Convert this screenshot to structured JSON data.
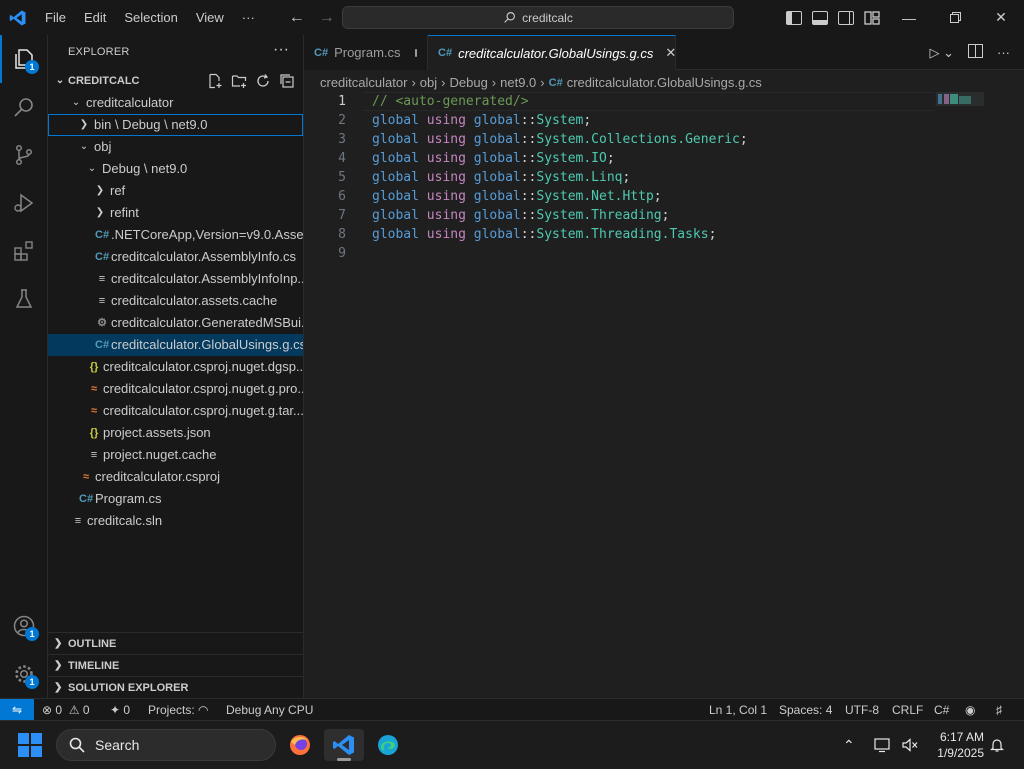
{
  "titlebar": {
    "menus": [
      "File",
      "Edit",
      "Selection",
      "View",
      "···"
    ],
    "search_text": "creditcalc"
  },
  "activity": {
    "explorer_badge": "1",
    "accounts_badge": "1",
    "manage_badge": "1"
  },
  "sidebar": {
    "title": "EXPLORER",
    "root": "CREDITCALC",
    "tree": [
      {
        "label": "creditcalculator",
        "depth": 1,
        "chevron": "down",
        "icon": ""
      },
      {
        "label": "bin \\ Debug \\ net9.0",
        "depth": 2,
        "chevron": "right",
        "icon": "",
        "focused": true
      },
      {
        "label": "obj",
        "depth": 2,
        "chevron": "down",
        "icon": ""
      },
      {
        "label": "Debug \\ net9.0",
        "depth": 3,
        "chevron": "down",
        "icon": ""
      },
      {
        "label": "ref",
        "depth": 4,
        "chevron": "right",
        "icon": ""
      },
      {
        "label": "refint",
        "depth": 4,
        "chevron": "right",
        "icon": ""
      },
      {
        "label": ".NETCoreApp,Version=v9.0.Asse...",
        "depth": 4,
        "chevron": "",
        "icon": "cs"
      },
      {
        "label": "creditcalculator.AssemblyInfo.cs",
        "depth": 4,
        "chevron": "",
        "icon": "cs"
      },
      {
        "label": "creditcalculator.AssemblyInfoInp...",
        "depth": 4,
        "chevron": "",
        "icon": "txt"
      },
      {
        "label": "creditcalculator.assets.cache",
        "depth": 4,
        "chevron": "",
        "icon": "txt"
      },
      {
        "label": "creditcalculator.GeneratedMSBui...",
        "depth": 4,
        "chevron": "",
        "icon": "gear"
      },
      {
        "label": "creditcalculator.GlobalUsings.g.cs",
        "depth": 4,
        "chevron": "",
        "icon": "cs",
        "selected": true
      },
      {
        "label": "creditcalculator.csproj.nuget.dgsp...",
        "depth": 3,
        "chevron": "",
        "icon": "json"
      },
      {
        "label": "creditcalculator.csproj.nuget.g.pro...",
        "depth": 3,
        "chevron": "",
        "icon": "xml"
      },
      {
        "label": "creditcalculator.csproj.nuget.g.tar...",
        "depth": 3,
        "chevron": "",
        "icon": "xml"
      },
      {
        "label": "project.assets.json",
        "depth": 3,
        "chevron": "",
        "icon": "json"
      },
      {
        "label": "project.nuget.cache",
        "depth": 3,
        "chevron": "",
        "icon": "txt"
      },
      {
        "label": "creditcalculator.csproj",
        "depth": 2,
        "chevron": "",
        "icon": "xml"
      },
      {
        "label": "Program.cs",
        "depth": 2,
        "chevron": "",
        "icon": "cs"
      },
      {
        "label": "creditcalc.sln",
        "depth": 1,
        "chevron": "",
        "icon": "txt"
      }
    ],
    "sections": [
      "OUTLINE",
      "TIMELINE",
      "SOLUTION EXPLORER"
    ]
  },
  "editor": {
    "tabs": [
      {
        "label": "Program.cs",
        "active": false,
        "modified": true
      },
      {
        "label": "creditcalculator.GlobalUsings.g.cs",
        "active": true,
        "modified": false
      }
    ],
    "breadcrumb": [
      "creditcalculator",
      "obj",
      "Debug",
      "net9.0",
      "creditcalculator.GlobalUsings.g.cs"
    ],
    "lines": [
      {
        "n": "1",
        "comment": "// <auto-generated/>"
      },
      {
        "n": "2",
        "ns": "System"
      },
      {
        "n": "3",
        "ns": "System.Collections.Generic"
      },
      {
        "n": "4",
        "ns": "System.IO"
      },
      {
        "n": "5",
        "ns": "System.Linq"
      },
      {
        "n": "6",
        "ns": "System.Net.Http"
      },
      {
        "n": "7",
        "ns": "System.Threading"
      },
      {
        "n": "8",
        "ns": "System.Threading.Tasks"
      },
      {
        "n": "9"
      }
    ],
    "kw_global": "global",
    "kw_using": "using",
    "kw_prefix": "global",
    "sep": "::",
    "semi": ";"
  },
  "statusbar": {
    "errors": "0",
    "warnings": "0",
    "ports": "0",
    "projects": "Projects:",
    "config": "Debug Any CPU",
    "position": "Ln 1, Col 1",
    "spaces": "Spaces: 4",
    "encoding": "UTF-8",
    "eol": "CRLF",
    "language": "C#"
  },
  "taskbar": {
    "search_label": "Search",
    "time": "6:17 AM",
    "date": "1/9/2025"
  },
  "colors": {
    "accent": "#0078d4",
    "keyword": "#569cd6",
    "control": "#c586c0",
    "type": "#4ec9b0",
    "comment": "#6a9955"
  }
}
